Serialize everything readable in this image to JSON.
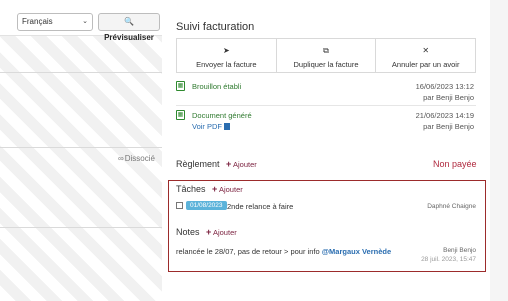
{
  "toolbar": {
    "language_value": "Français",
    "preview_label": "Prévisualiser",
    "dissocie_label": "Dissocié"
  },
  "billing": {
    "title": "Suivi facturation",
    "actions": [
      {
        "icon": "send-icon",
        "label": "Envoyer la facture"
      },
      {
        "icon": "copy-icon",
        "label": "Dupliquer la facture"
      },
      {
        "icon": "close-icon",
        "label": "Annuler par un avoir"
      }
    ],
    "events": [
      {
        "title": "Brouillon établi",
        "date": "16/06/2023 13:12",
        "by": "par Benji Benjo",
        "link": ""
      },
      {
        "title": "Document généré",
        "date": "21/06/2023 14:19",
        "by": "par Benji Benjo",
        "link": "Voir PDF"
      }
    ]
  },
  "reglement": {
    "title": "Règlement",
    "add_label": "Ajouter",
    "status": "Non payée"
  },
  "tasks": {
    "title": "Tâches",
    "add_label": "Ajouter",
    "items": [
      {
        "date": "01/08/2023",
        "text": "2nde relance à faire",
        "assignee": "Daphné Chaigne"
      }
    ]
  },
  "notes": {
    "title": "Notes",
    "add_label": "Ajouter",
    "items": [
      {
        "text": "relancée le 28/07, pas de retour >  pour info ",
        "mention": "@Margaux Vernède",
        "author": "Benji Benjo",
        "date": "28 juil. 2023, 15:47"
      }
    ]
  },
  "colors": {
    "accent": "#7a1f3d",
    "unpaid": "#b0293e",
    "highlight_box": "#9c2b2b",
    "date_badge": "#5cb3da",
    "success": "#2f7a2f",
    "link": "#2a6db0"
  }
}
